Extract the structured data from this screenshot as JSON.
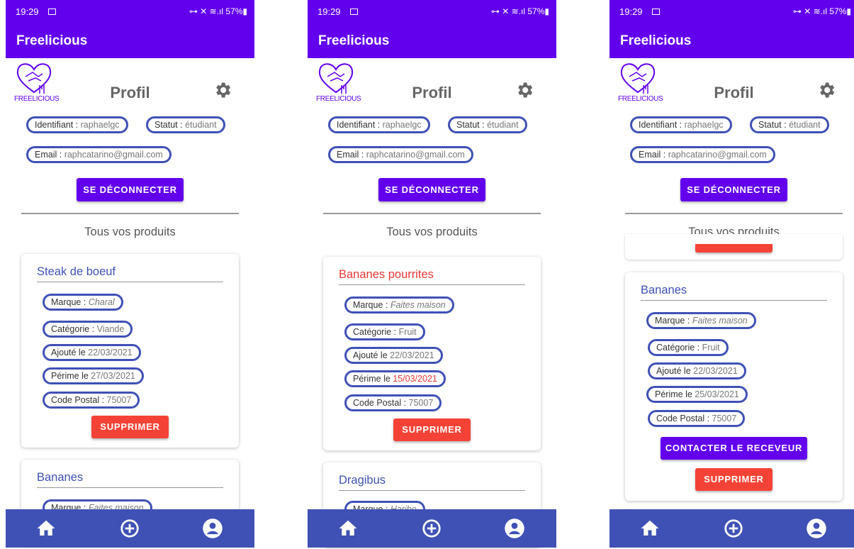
{
  "screens": [
    {
      "status": {
        "time": "19:29",
        "indicators": "⊶ ✕ ≋.ıl 57%▮"
      },
      "appbar": {
        "title": "Freelicious"
      },
      "header": {
        "logo_text": "FREELICIOUS",
        "title": "Profil"
      },
      "profile": {
        "id_label": "Identifiant :",
        "id_value": "raphaelgc",
        "status_label": "Statut :",
        "status_value": "étudiant",
        "email_label": "Email :",
        "email_value": "raphcatarino@gmail.com",
        "logout": "SE DÉCONNECTER"
      },
      "products_heading": "Tous vos produits",
      "card1": {
        "title": "Steak de boeuf",
        "marque_label": "Marque :",
        "marque": "Charal",
        "cat_label": "Catégorie :",
        "cat": "Viande",
        "added_label": "Ajouté le",
        "added": "22/03/2021",
        "exp_label": "Périme le",
        "exp": "27/03/2021",
        "cp_label": "Code Postal :",
        "cp": "75007",
        "delete": "SUPPRIMER"
      },
      "card2": {
        "title": "Bananes",
        "marque_label": "Marque :",
        "marque": "Faites maison"
      }
    },
    {
      "status": {
        "time": "19:29",
        "indicators": "⊶ ✕ ≋.ıl 57%▮"
      },
      "appbar": {
        "title": "Freelicious"
      },
      "header": {
        "logo_text": "FREELICIOUS",
        "title": "Profil"
      },
      "profile": {
        "id_label": "Identifiant :",
        "id_value": "raphaelgc",
        "status_label": "Statut :",
        "status_value": "étudiant",
        "email_label": "Email :",
        "email_value": "raphcatarino@gmail.com",
        "logout": "SE DÉCONNECTER"
      },
      "products_heading": "Tous vos produits",
      "card1": {
        "title": "Bananes pourrites",
        "marque_label": "Marque :",
        "marque": "Faites maison",
        "cat_label": "Catégorie :",
        "cat": "Fruit",
        "added_label": "Ajouté le",
        "added": "22/03/2021",
        "exp_label": "Périme le",
        "exp": "15/03/2021",
        "cp_label": "Code Postal :",
        "cp": "75007",
        "delete": "SUPPRIMER"
      },
      "card2": {
        "title": "Dragibus",
        "marque_label": "Marque :",
        "marque": "Haribo"
      }
    },
    {
      "status": {
        "time": "19:29",
        "indicators": "⊶ ✕ ≋.ıl 57%▮"
      },
      "appbar": {
        "title": "Freelicious"
      },
      "header": {
        "logo_text": "FREELICIOUS",
        "title": "Profil"
      },
      "profile": {
        "id_label": "Identifiant :",
        "id_value": "raphaelgc",
        "status_label": "Statut :",
        "status_value": "étudiant",
        "email_label": "Email :",
        "email_value": "raphcatarino@gmail.com",
        "logout": "SE DÉCONNECTER"
      },
      "products_heading": "Tous vos produits",
      "card1": {
        "title": "Bananes",
        "marque_label": "Marque :",
        "marque": "Faites maison",
        "cat_label": "Catégorie :",
        "cat": "Fruit",
        "added_label": "Ajouté le",
        "added": "22/03/2021",
        "exp_label": "Périme le",
        "exp": "25/03/2021",
        "cp_label": "Code Postal :",
        "cp": "75007",
        "contact": "CONTACTER LE RECEVEUR",
        "delete": "SUPPRIMER"
      }
    }
  ],
  "nav": {
    "icons": [
      "home-icon",
      "add-circle-icon",
      "account-icon"
    ]
  },
  "colors": {
    "primary": "#6200ee",
    "indigo": "#3f51b5",
    "red": "#f44336"
  }
}
